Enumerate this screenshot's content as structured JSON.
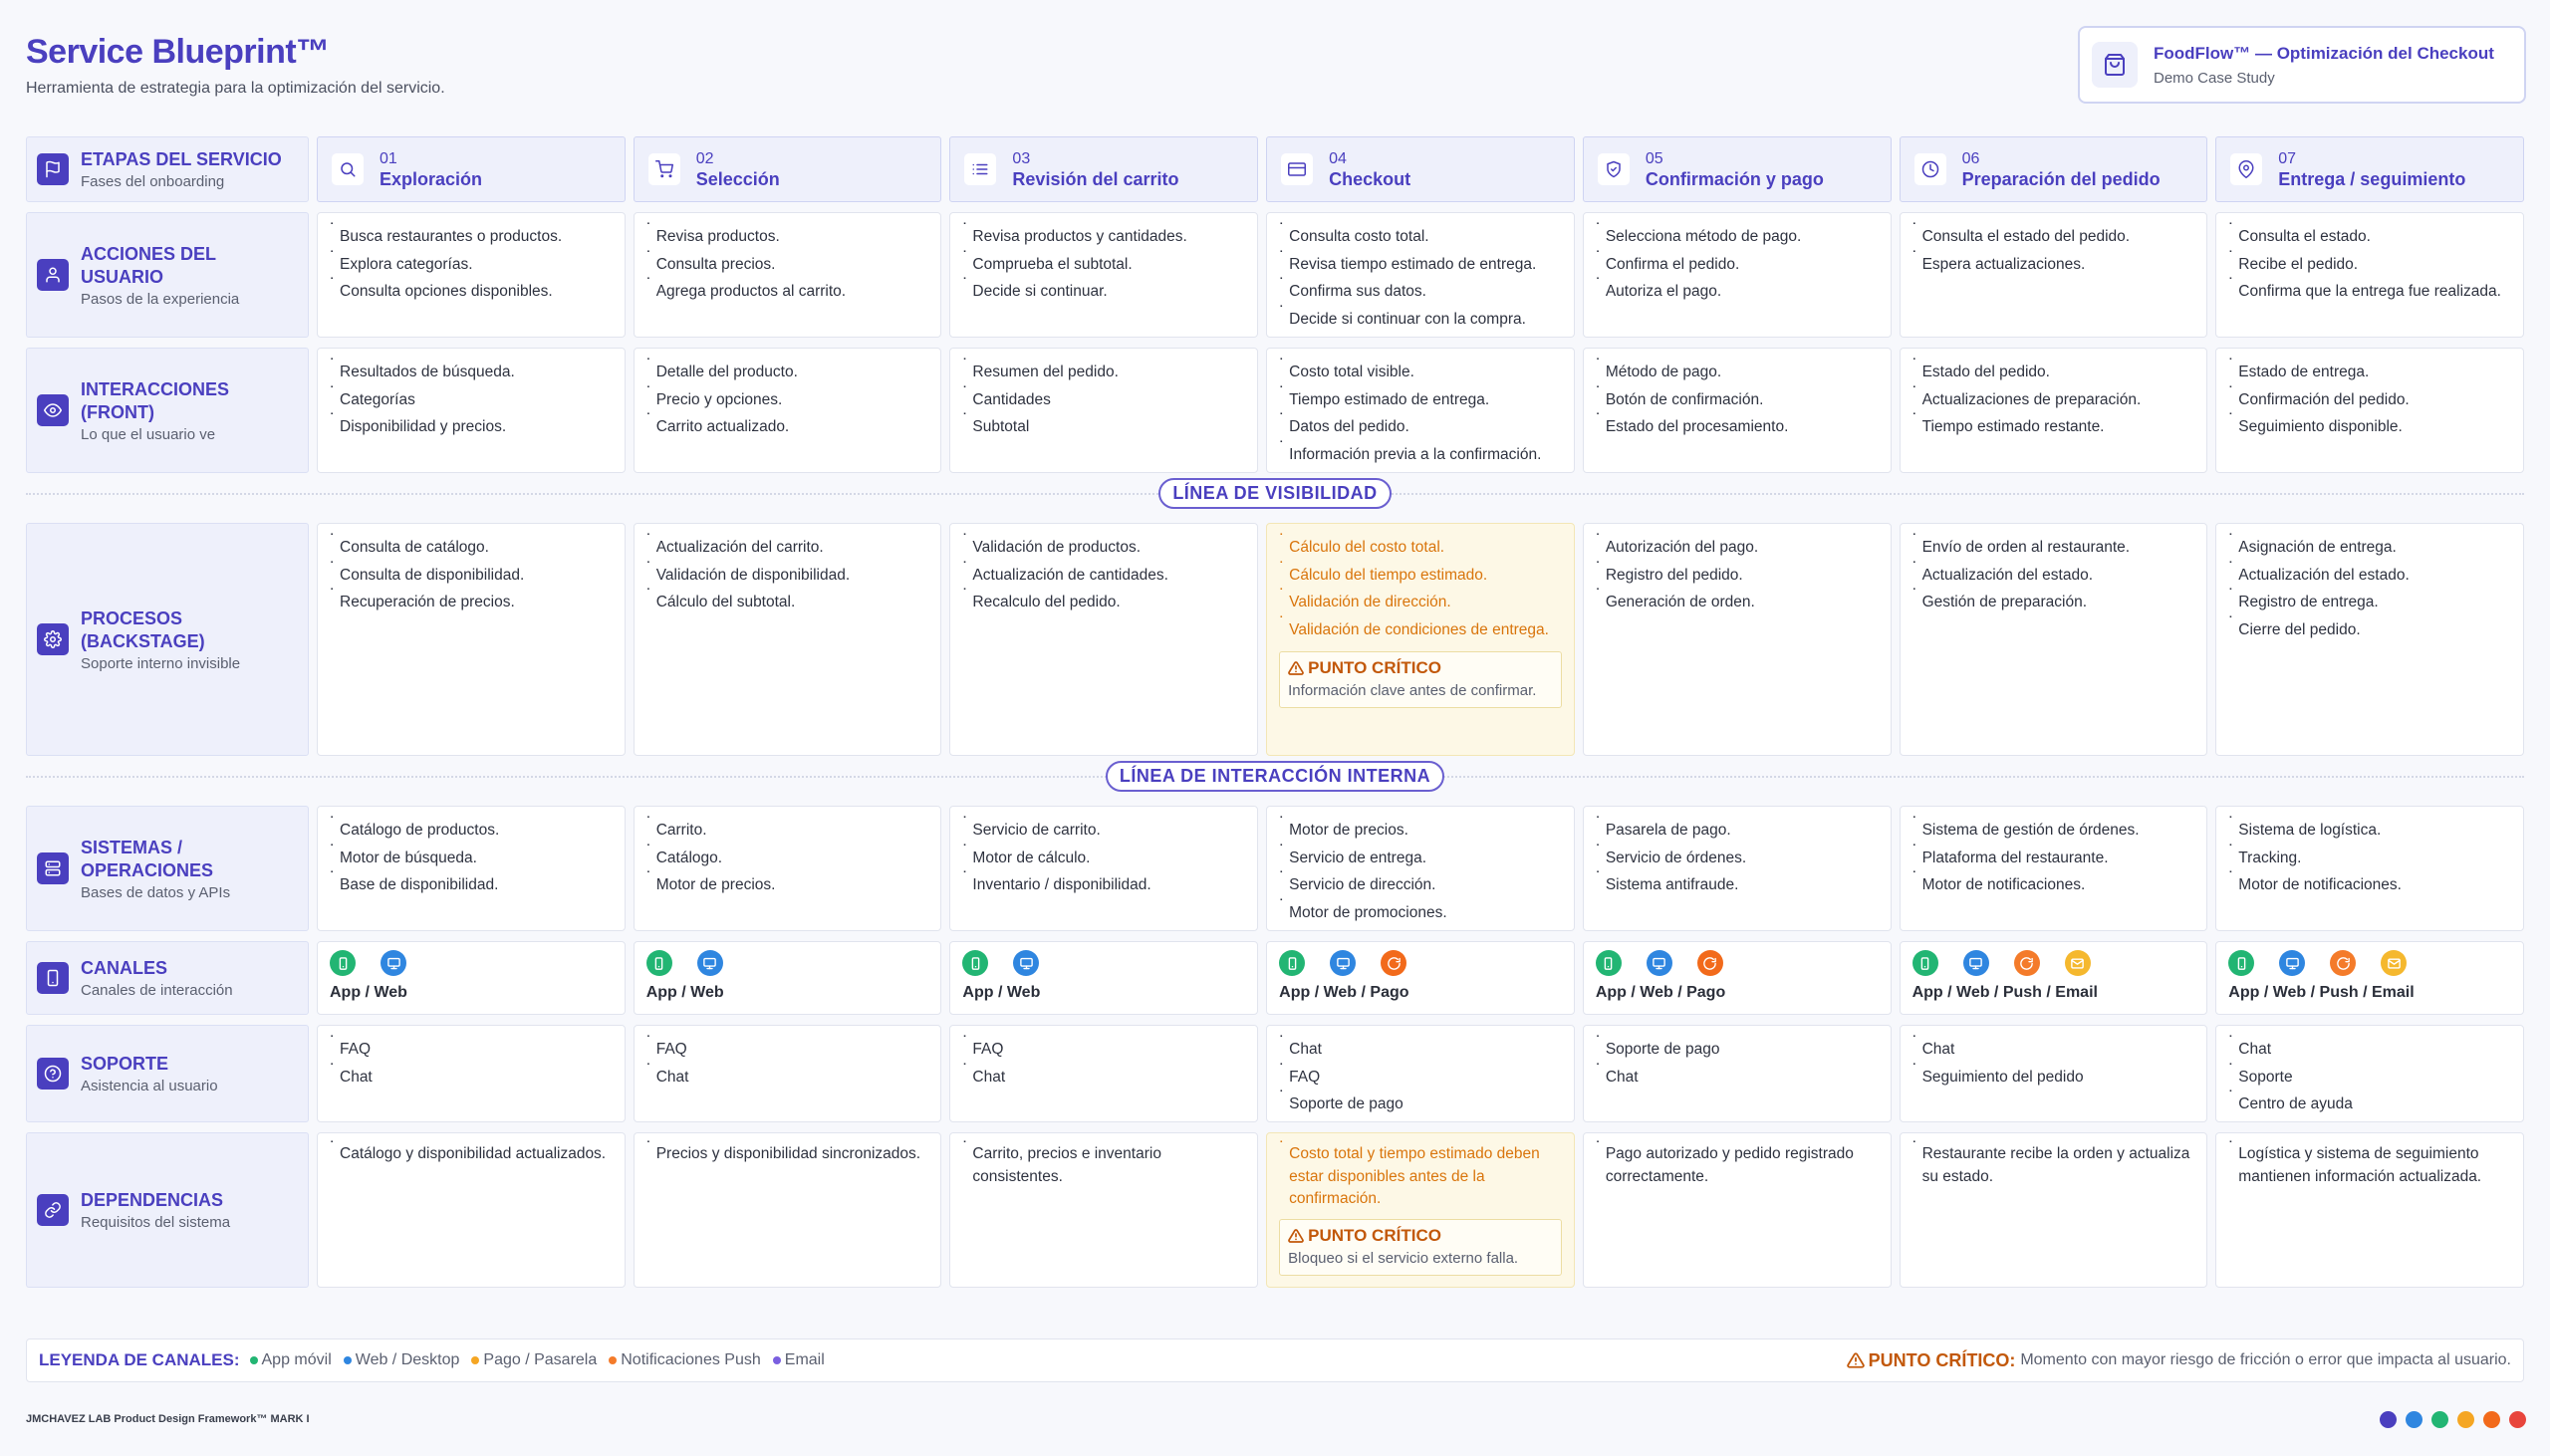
{
  "header": {
    "title": "Service Blueprint™",
    "subtitle": "Herramienta de estrategia para la optimización del servicio."
  },
  "project": {
    "title": "FoodFlow™ — Optimización del Checkout",
    "subtitle": "Demo Case Study",
    "icon": "shopping-bag-icon"
  },
  "stages_label": {
    "title": "ETAPAS DEL SERVICIO",
    "subtitle": "Fases del onboarding",
    "icon": "flag-icon"
  },
  "stages": [
    {
      "num": "01",
      "name": "Exploración",
      "icon": "search-icon"
    },
    {
      "num": "02",
      "name": "Selección",
      "icon": "cart-icon"
    },
    {
      "num": "03",
      "name": "Revisión del carrito",
      "icon": "list-icon"
    },
    {
      "num": "04",
      "name": "Checkout",
      "icon": "credit-card-icon"
    },
    {
      "num": "05",
      "name": "Confirmación y pago",
      "icon": "shield-check-icon"
    },
    {
      "num": "06",
      "name": "Preparación del pedido",
      "icon": "clock-icon"
    },
    {
      "num": "07",
      "name": "Entrega / seguimiento",
      "icon": "location-pin-icon"
    }
  ],
  "dividers": {
    "visibility": "LÍNEA DE VISIBILIDAD",
    "internal": "LÍNEA DE INTERACCIÓN INTERNA"
  },
  "rows": {
    "acciones": {
      "title": "ACCIONES DEL USUARIO",
      "subtitle": "Pasos de la experiencia",
      "icon": "user-icon",
      "cells": [
        [
          "Busca restaurantes o productos.",
          "Explora categorías.",
          "Consulta opciones disponibles."
        ],
        [
          "Revisa productos.",
          "Consulta precios.",
          "Agrega productos al carrito."
        ],
        [
          "Revisa productos y cantidades.",
          "Comprueba el subtotal.",
          "Decide si continuar."
        ],
        [
          "Consulta costo total.",
          "Revisa tiempo estimado de entrega.",
          "Confirma sus datos.",
          "Decide si continuar con la compra."
        ],
        [
          "Selecciona método de pago.",
          "Confirma el pedido.",
          "Autoriza el pago."
        ],
        [
          "Consulta el estado del pedido.",
          "Espera actualizaciones."
        ],
        [
          "Consulta el estado.",
          "Recibe el pedido.",
          "Confirma que la entrega fue realizada."
        ]
      ]
    },
    "interacciones": {
      "title": "INTERACCIONES (FRONT)",
      "subtitle": "Lo que el usuario ve",
      "icon": "eye-icon",
      "cells": [
        [
          "Resultados de búsqueda.",
          "Categorías",
          "Disponibilidad y precios."
        ],
        [
          "Detalle del producto.",
          "Precio y opciones.",
          "Carrito actualizado."
        ],
        [
          "Resumen del pedido.",
          "Cantidades",
          "Subtotal"
        ],
        [
          "Costo total visible.",
          "Tiempo estimado de entrega.",
          "Datos del pedido.",
          "Información previa a la confirmación."
        ],
        [
          "Método de pago.",
          "Botón de confirmación.",
          "Estado del procesamiento."
        ],
        [
          "Estado del pedido.",
          "Actualizaciones de preparación.",
          "Tiempo estimado restante."
        ],
        [
          "Estado de entrega.",
          "Confirmación del pedido.",
          "Seguimiento disponible."
        ]
      ]
    },
    "procesos": {
      "title": "PROCESOS (BACKSTAGE)",
      "subtitle": "Soporte interno invisible",
      "icon": "gear-icon",
      "cells": [
        [
          "Consulta de catálogo.",
          "Consulta de disponibilidad.",
          "Recuperación de precios."
        ],
        [
          "Actualización del carrito.",
          "Validación de disponibilidad.",
          "Cálculo del subtotal."
        ],
        [
          "Validación de productos.",
          "Actualización de cantidades.",
          "Recalculo del pedido."
        ],
        [
          "Cálculo del costo total.",
          "Cálculo del tiempo estimado.",
          "Validación de dirección.",
          "Validación de condiciones de entrega."
        ],
        [
          "Autorización del pago.",
          "Registro del pedido.",
          "Generación de orden."
        ],
        [
          "Envío de orden al restaurante.",
          "Actualización del estado.",
          "Gestión de preparación."
        ],
        [
          "Asignación de entrega.",
          "Actualización del estado.",
          "Registro de entrega.",
          "Cierre del pedido."
        ]
      ],
      "critical": {
        "title": "PUNTO CRÍTICO",
        "text": "Información clave antes de confirmar."
      }
    },
    "sistemas": {
      "title": "SISTEMAS / OPERACIONES",
      "subtitle": "Bases de datos y APIs",
      "icon": "server-icon",
      "cells": [
        [
          "Catálogo de productos.",
          "Motor de búsqueda.",
          "Base de disponibilidad."
        ],
        [
          "Carrito.",
          "Catálogo.",
          "Motor de precios."
        ],
        [
          "Servicio de carrito.",
          "Motor de cálculo.",
          "Inventario / disponibilidad."
        ],
        [
          "Motor de precios.",
          "Servicio de entrega.",
          "Servicio de dirección.",
          "Motor de promociones."
        ],
        [
          "Pasarela de pago.",
          "Servicio de órdenes.",
          "Sistema antifraude."
        ],
        [
          "Sistema de gestión de órdenes.",
          "Plataforma del restaurante.",
          "Motor de notificaciones."
        ],
        [
          "Sistema de logística.",
          "Tracking.",
          "Motor de notificaciones."
        ]
      ]
    },
    "canales": {
      "title": "CANALES",
      "subtitle": "Canales de interacción",
      "icon": "phone-icon",
      "cells": [
        {
          "icons": [
            "app",
            "web"
          ],
          "label": "App / Web"
        },
        {
          "icons": [
            "app",
            "web"
          ],
          "label": "App / Web"
        },
        {
          "icons": [
            "app",
            "web"
          ],
          "label": "App / Web"
        },
        {
          "icons": [
            "app",
            "web",
            "pago"
          ],
          "label": "App / Web / Pago"
        },
        {
          "icons": [
            "app",
            "web",
            "pago"
          ],
          "label": "App / Web / Pago"
        },
        {
          "icons": [
            "app",
            "web",
            "push",
            "email"
          ],
          "label": "App / Web / Push / Email"
        },
        {
          "icons": [
            "app",
            "web",
            "push",
            "email"
          ],
          "label": "App / Web / Push / Email"
        }
      ]
    },
    "soporte": {
      "title": "SOPORTE",
      "subtitle": "Asistencia al usuario",
      "icon": "help-circle-icon",
      "cells": [
        [
          "FAQ",
          "Chat"
        ],
        [
          "FAQ",
          "Chat"
        ],
        [
          "FAQ",
          "Chat"
        ],
        [
          "Chat",
          "FAQ",
          "Soporte de pago"
        ],
        [
          "Soporte de pago",
          "Chat"
        ],
        [
          "Chat",
          "Seguimiento del pedido"
        ],
        [
          "Chat",
          "Soporte",
          "Centro de ayuda"
        ]
      ]
    },
    "dependencias": {
      "title": "DEPENDENCIAS",
      "subtitle": "Requisitos del sistema",
      "icon": "link-icon",
      "cells": [
        [
          "Catálogo y disponibilidad actualizados."
        ],
        [
          "Precios y disponibilidad sincronizados."
        ],
        [
          "Carrito, precios e inventario consistentes."
        ],
        [
          "Costo total y tiempo estimado deben estar disponibles antes de la confirmación."
        ],
        [
          "Pago autorizado y pedido registrado correctamente."
        ],
        [
          "Restaurante recibe la orden y actualiza su estado."
        ],
        [
          "Logística y sistema de seguimiento mantienen información actualizada."
        ]
      ],
      "critical": {
        "title": "PUNTO CRÍTICO",
        "text": "Bloqueo si el servicio externo falla."
      }
    }
  },
  "channel_colors": {
    "app": "#22b573",
    "web": "#2f86e0",
    "pago": "#f26a1b",
    "push": "#f47b2a",
    "email": "#f5b82e"
  },
  "legend": {
    "title": "LEYENDA DE CANALES:",
    "items": [
      {
        "label": "App móvil",
        "color": "#22b573"
      },
      {
        "label": "Web / Desktop",
        "color": "#2f86e0"
      },
      {
        "label": "Pago / Pasarela",
        "color": "#f5a623"
      },
      {
        "label": "Notificaciones Push",
        "color": "#f47b2a"
      },
      {
        "label": "Email",
        "color": "#7a5fe0"
      }
    ],
    "critical_label": "PUNTO CRÍTICO:",
    "critical_text": "Momento con mayor riesgo de fricción o error que impacta al usuario."
  },
  "footer": {
    "text": "JMCHAVEZ LAB Product Design Framework™ MARK I",
    "dots": [
      "#4a3fbf",
      "#2f86e0",
      "#22b573",
      "#f5a623",
      "#f26a1b",
      "#e8453c"
    ]
  },
  "colors": {
    "accent": "#4a3fbf",
    "critical": "#d9750c"
  }
}
